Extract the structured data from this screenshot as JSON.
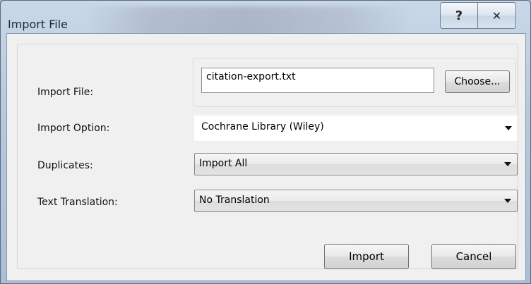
{
  "window": {
    "title": "Import File",
    "help_glyph": "?",
    "close_glyph": "✕"
  },
  "form": {
    "import_file_label": "Import File:",
    "import_file_value": "citation-export.txt",
    "choose_label": "Choose...",
    "import_option_label": "Import Option:",
    "import_option_value": "Cochrane Library (Wiley)",
    "duplicates_label": "Duplicates:",
    "duplicates_value": "Import All",
    "translation_label": "Text Translation:",
    "translation_value": "No Translation"
  },
  "actions": {
    "import_label": "Import",
    "cancel_label": "Cancel"
  }
}
